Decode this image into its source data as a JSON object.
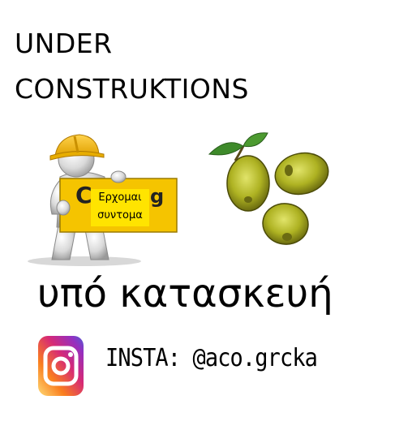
{
  "heading": {
    "line1": "UNDER",
    "line2": "CONSTRUKTIONS"
  },
  "construction_sign": {
    "background_letter_left": "C",
    "background_letter_right": "g",
    "sticker_line1": "Ερχομαι",
    "sticker_line2": "συντομα"
  },
  "greek_heading": "υπό κατασκευή",
  "instagram": {
    "icon": "instagram-icon",
    "handle_text": "INSTA: @aco.grcka"
  },
  "colors": {
    "sign_yellow": "#f5c400",
    "sticker_yellow": "#ffe400",
    "olive_green": "#a5ab1f",
    "leaf_green": "#3e8a2a"
  }
}
